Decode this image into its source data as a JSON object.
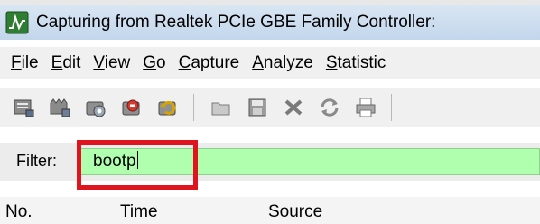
{
  "window": {
    "title": "Capturing from Realtek PCIe GBE Family Controller:"
  },
  "menu": [
    {
      "accel": "F",
      "rest": "ile"
    },
    {
      "accel": "E",
      "rest": "dit"
    },
    {
      "accel": "V",
      "rest": "iew"
    },
    {
      "accel": "G",
      "rest": "o"
    },
    {
      "accel": "C",
      "rest": "apture"
    },
    {
      "accel": "A",
      "rest": "nalyze"
    },
    {
      "accel": "S",
      "rest": "tatistic"
    }
  ],
  "toolbar": {
    "icons": [
      "interface-list-icon",
      "capture-options-icon",
      "start-capture-icon",
      "stop-capture-icon",
      "restart-capture-icon",
      "open-file-icon",
      "save-file-icon",
      "close-file-icon",
      "reload-icon",
      "print-icon"
    ]
  },
  "filter": {
    "label": "Filter:",
    "value": "bootp",
    "bg_color": "#afffaf"
  },
  "highlight": {
    "color": "#e0141e"
  },
  "columns": [
    "No.",
    "Time",
    "Source"
  ]
}
